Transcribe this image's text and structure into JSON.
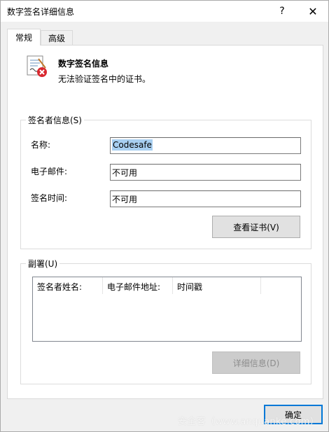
{
  "window": {
    "title": "数字签名详细信息",
    "help_label": "?",
    "close_label": "✕"
  },
  "tabs": [
    {
      "label": "常规",
      "active": true
    },
    {
      "label": "高级",
      "active": false
    }
  ],
  "header": {
    "icon": "certificate-error-icon",
    "title": "数字签名信息",
    "message": "无法验证签名中的证书。"
  },
  "signer_group": {
    "legend": "签名者信息(S)",
    "fields": [
      {
        "label": "名称:",
        "value": "Codesafe"
      },
      {
        "label": "电子邮件:",
        "value": "不可用"
      },
      {
        "label": "签名时间:",
        "value": "不可用"
      }
    ],
    "view_cert_button": "查看证书(V)"
  },
  "countersig_group": {
    "legend": "副署(U)",
    "columns": [
      "签名者姓名:",
      "电子邮件地址:",
      "时间戳"
    ],
    "details_button": "详细信息(D)"
  },
  "ok_button": "确定",
  "watermark": "安全客（www.anquanke.com）",
  "colors": {
    "accent": "#0078d7",
    "selection": "#a8cff1",
    "error_badge": "#d9282f"
  }
}
